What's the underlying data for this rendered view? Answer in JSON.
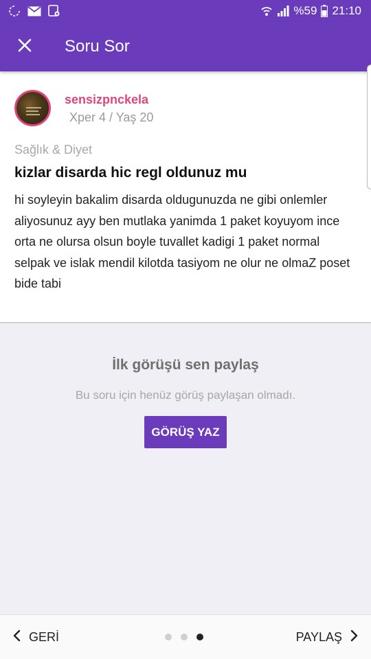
{
  "status_bar": {
    "battery": "%59",
    "time": "21:10",
    "icons": [
      "sync-icon",
      "mail-icon",
      "gallery-notification-icon",
      "wifi-icon",
      "signal-icon",
      "battery-icon"
    ]
  },
  "app_bar": {
    "close_icon": "close-icon",
    "title": "Soru Sor"
  },
  "question": {
    "username": "sensizpnckela",
    "user_meta": "Xper 4 / Yaş 20",
    "category": "Sağlık & Diyet",
    "title": "kizlar disarda hic regl oldunuz mu",
    "body": "hi soyleyin bakalim disarda oldugunuzda ne gibi onlemler aliyosunuz ayy ben mutlaka yanimda 1 paket koyuyom ince orta ne olursa olsun boyle tuvallet kadigi 1 paket normal selpak ve islak mendil kilotda tasiyom ne olur ne olmaZ poset bide tabi"
  },
  "empty_state": {
    "title": "İlk görüşü sen paylaş",
    "subtitle": "Bu soru için henüz görüş paylaşan olmadı.",
    "button_label": "GÖRÜŞ YAZ"
  },
  "bottom_bar": {
    "back_label": "GERİ",
    "share_label": "PAYLAŞ",
    "page_dots_total": 3,
    "page_dots_active": 3
  },
  "colors": {
    "primary": "#6a3cbc",
    "username": "#e0457b"
  }
}
